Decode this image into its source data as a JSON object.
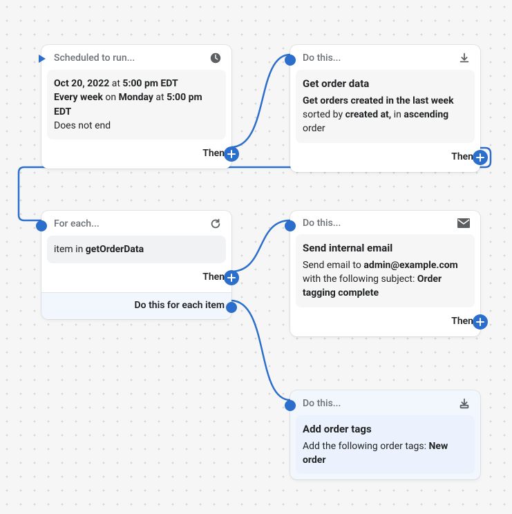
{
  "node1": {
    "header": "Scheduled to run...",
    "date": "Oct 20, 2022",
    "at1": " at ",
    "time1": "5:00 pm EDT",
    "recur": "Every week",
    "on": " on ",
    "day": "Monday",
    "at2": " at ",
    "time2": "5:00 pm EDT",
    "end": "Does not end",
    "then": "Then"
  },
  "node2": {
    "header": "Do this...",
    "title": "Get order data",
    "pre1": "Get orders created in the last week",
    "mid1": " sorted by ",
    "sort": "created at,",
    "mid2": " in ",
    "dir": "ascending",
    "mid3": " order",
    "then": "Then"
  },
  "node3": {
    "header": "For each...",
    "item": "item in ",
    "var": "getOrderData",
    "then": "Then",
    "sub": "Do this for each item"
  },
  "node4": {
    "header": "Do this...",
    "title": "Send internal email",
    "pre": "Send email to ",
    "addr": "admin@example.com",
    "mid": " with the following subject: ",
    "subj": "Order tagging complete",
    "then": "Then"
  },
  "node5": {
    "header": "Do this...",
    "title": "Add order tags",
    "pre": "Add the following order tags: ",
    "tag": "New order"
  }
}
